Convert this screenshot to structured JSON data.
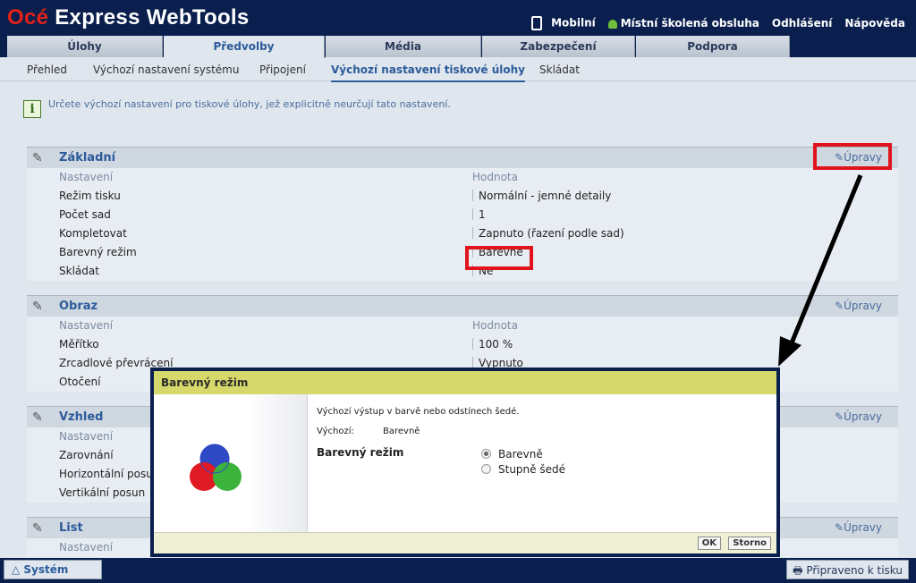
{
  "brand": {
    "oce": "Océ",
    "rest": " Express WebTools"
  },
  "top_links": {
    "mobile": "Mobilní",
    "user": "Místní školená obsluha",
    "logout": "Odhlášení",
    "help": "Nápověda"
  },
  "tabs": [
    "Úlohy",
    "Předvolby",
    "Média",
    "Zabezpečení",
    "Podpora"
  ],
  "active_tab": "Předvolby",
  "subnav": [
    "Přehled",
    "Výchozí nastavení systému",
    "Připojení",
    "Výchozí nastavení tiskové úlohy",
    "Skládat"
  ],
  "info_text": "Určete výchozí nastavení pro tiskové úlohy, jež explicitně neurčují tato nastavení.",
  "edit_label": "Úpravy",
  "col_setting": "Nastavení",
  "col_value": "Hodnota",
  "sections": {
    "basic": {
      "title": "Základní",
      "rows": [
        {
          "k": "Režim tisku",
          "v": "Normální - jemné detaily"
        },
        {
          "k": "Počet sad",
          "v": "1"
        },
        {
          "k": "Kompletovat",
          "v": "Zapnuto (řazení podle sad)"
        },
        {
          "k": "Barevný režim",
          "v": "Barevně"
        },
        {
          "k": "Skládat",
          "v": "Ne"
        }
      ]
    },
    "image": {
      "title": "Obraz",
      "rows": [
        {
          "k": "Měřítko",
          "v": "100 %"
        },
        {
          "k": "Zrcadlové převrácení",
          "v": "Vypnuto"
        },
        {
          "k": "Otočení",
          "v": ""
        }
      ]
    },
    "look": {
      "title": "Vzhled",
      "rows": [
        {
          "k": "Zarovnání",
          "v": ""
        },
        {
          "k": "Horizontální posun",
          "v": ""
        },
        {
          "k": "Vertikální posun",
          "v": ""
        }
      ]
    },
    "sheet": {
      "title": "List"
    }
  },
  "dialog": {
    "title": "Barevný režim",
    "description": "Výchozí výstup v barvě nebo odstínech šedé.",
    "default_label": "Výchozí:",
    "default_value": "Barevně",
    "field_label": "Barevný režim",
    "options": [
      "Barevně",
      "Stupně šedé"
    ],
    "selected": "Barevně",
    "ok": "OK",
    "cancel": "Storno"
  },
  "status": {
    "system_tab": "Systém",
    "ready": "Připraveno k tisku"
  },
  "colors": {
    "navy": "#0a1f4e",
    "accent": "#2c5b9a",
    "highlight": "#e1131c",
    "dialog_title": "#d7d86b"
  }
}
